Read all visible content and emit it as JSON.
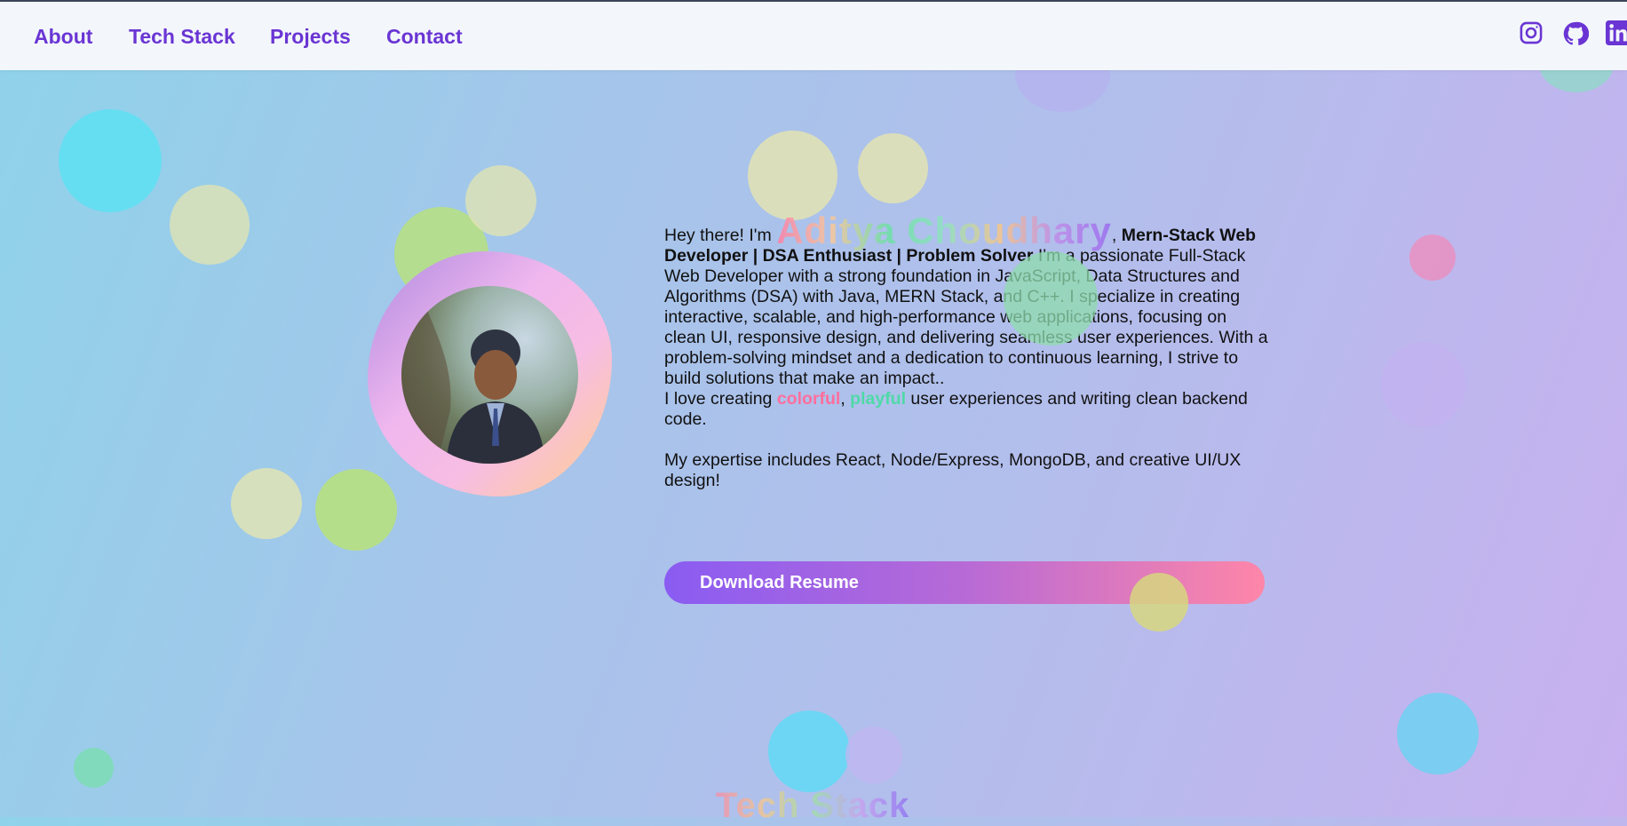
{
  "nav": {
    "items": [
      "About",
      "Tech Stack",
      "Projects",
      "Contact"
    ]
  },
  "social": [
    "instagram-icon",
    "github-icon",
    "linkedin-icon"
  ],
  "hero": {
    "greeting": "Hey there! I'm ",
    "name": "Aditya Choudhary",
    "comma": ",",
    "role": "Mern-Stack Web Developer | DSA Enthusiast | Problem Solver",
    "bio": " I'm a passionate Full-Stack Web Developer with a strong foundation in JavaScript, Data Structures and Algorithms (DSA) with Java, MERN Stack, and C++. I specialize in creating interactive, scalable, and high-performance web applications, focusing on clean UI, responsive design, and delivering seamless user experiences. With a problem-solving mindset and a dedication to continuous learning, I strive to build solutions that make an impact..",
    "love_prefix": "I love creating ",
    "love_word1": "colorful",
    "love_sep": ", ",
    "love_word2": "playful",
    "love_suffix": " user experiences and writing clean backend code.",
    "expertise": "My expertise includes React, Node/Express, MongoDB, and creative UI/UX design!",
    "resume_button": "Download Resume"
  },
  "next_section": {
    "title": "Tech Stack"
  },
  "colors": {
    "accent": "#6a35d4",
    "button_start": "#8a5cf2",
    "button_end": "#fe86a8",
    "highlight_pink": "#ff6f9d",
    "highlight_mint": "#4fd9a7"
  }
}
